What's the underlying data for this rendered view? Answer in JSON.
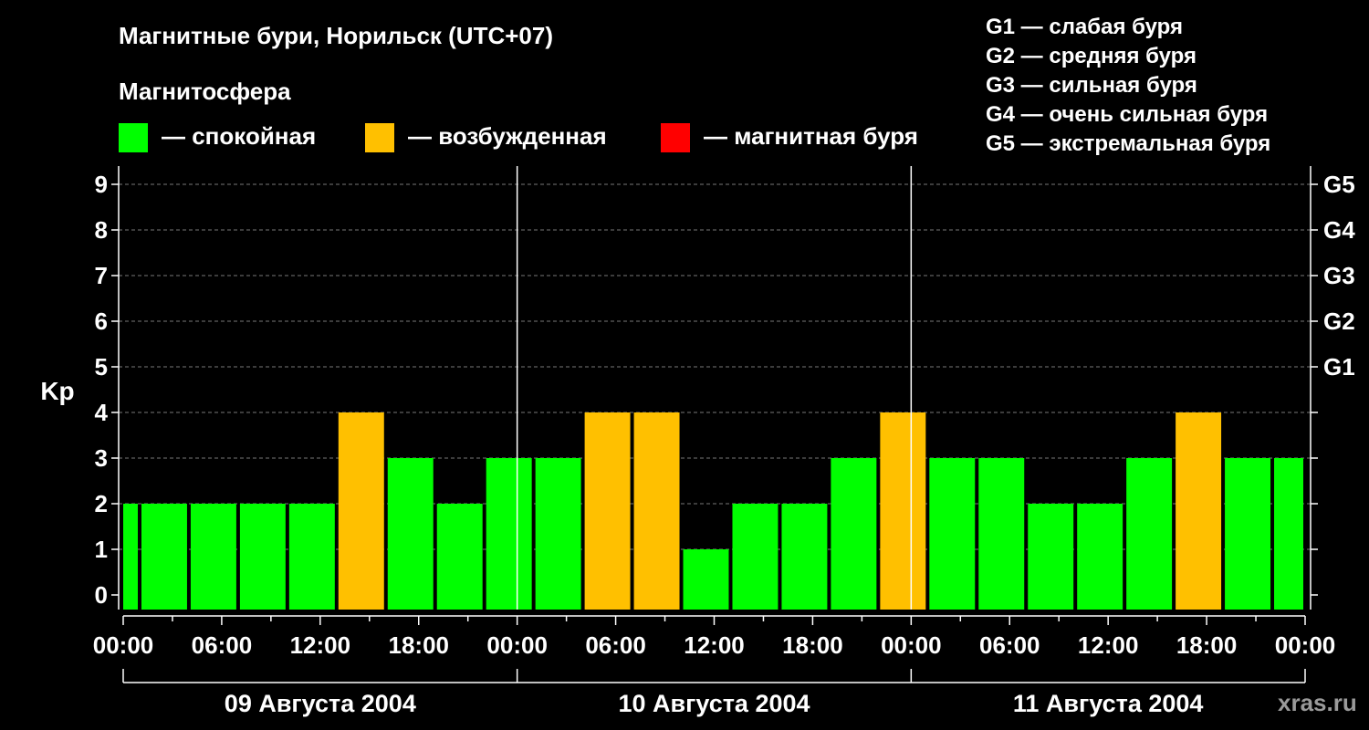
{
  "title": "Магнитные бури, Норильск (UTC+07)",
  "legend": {
    "heading": "Магнитосфера",
    "items": [
      {
        "label": "— спокойная",
        "color": "#00ff00"
      },
      {
        "label": "— возбужденная",
        "color": "#ffc000"
      },
      {
        "label": "— магнитная буря",
        "color": "#ff0000"
      }
    ]
  },
  "storm_scale": [
    "G1 — слабая буря",
    "G2 — средняя буря",
    "G3 — сильная буря",
    "G4 — очень сильная буря",
    "G5 — экстремальная буря"
  ],
  "watermark": "xras.ru",
  "chart_data": {
    "type": "bar",
    "ylabel": "Kp",
    "ylim": [
      0,
      9
    ],
    "yticks": [
      0,
      1,
      2,
      3,
      4,
      5,
      6,
      7,
      8,
      9
    ],
    "right_ticks": [
      {
        "value": 5,
        "label": "G1"
      },
      {
        "value": 6,
        "label": "G2"
      },
      {
        "value": 7,
        "label": "G3"
      },
      {
        "value": 8,
        "label": "G4"
      },
      {
        "value": 9,
        "label": "G5"
      }
    ],
    "grid": true,
    "x_hours_total": 72,
    "xtick_labels": [
      "00:00",
      "06:00",
      "12:00",
      "18:00",
      "00:00",
      "06:00",
      "12:00",
      "18:00",
      "00:00",
      "06:00",
      "12:00",
      "18:00",
      "00:00"
    ],
    "days": [
      "09 Августа 2004",
      "10 Августа 2004",
      "11 Августа 2004"
    ],
    "bar_interval_hours": 3,
    "first_bar_start_hour": -2,
    "values": [
      2,
      2,
      2,
      2,
      2,
      4,
      3,
      2,
      3,
      3,
      4,
      4,
      1,
      2,
      2,
      3,
      4,
      3,
      3,
      2,
      2,
      3,
      4,
      3,
      3
    ],
    "status": [
      "quiet",
      "quiet",
      "quiet",
      "quiet",
      "quiet",
      "active",
      "quiet",
      "quiet",
      "quiet",
      "quiet",
      "active",
      "active",
      "quiet",
      "quiet",
      "quiet",
      "quiet",
      "active",
      "quiet",
      "quiet",
      "quiet",
      "quiet",
      "quiet",
      "active",
      "quiet",
      "quiet"
    ],
    "status_colors": {
      "quiet": "#00ff00",
      "active": "#ffc000",
      "storm": "#ff0000"
    }
  }
}
